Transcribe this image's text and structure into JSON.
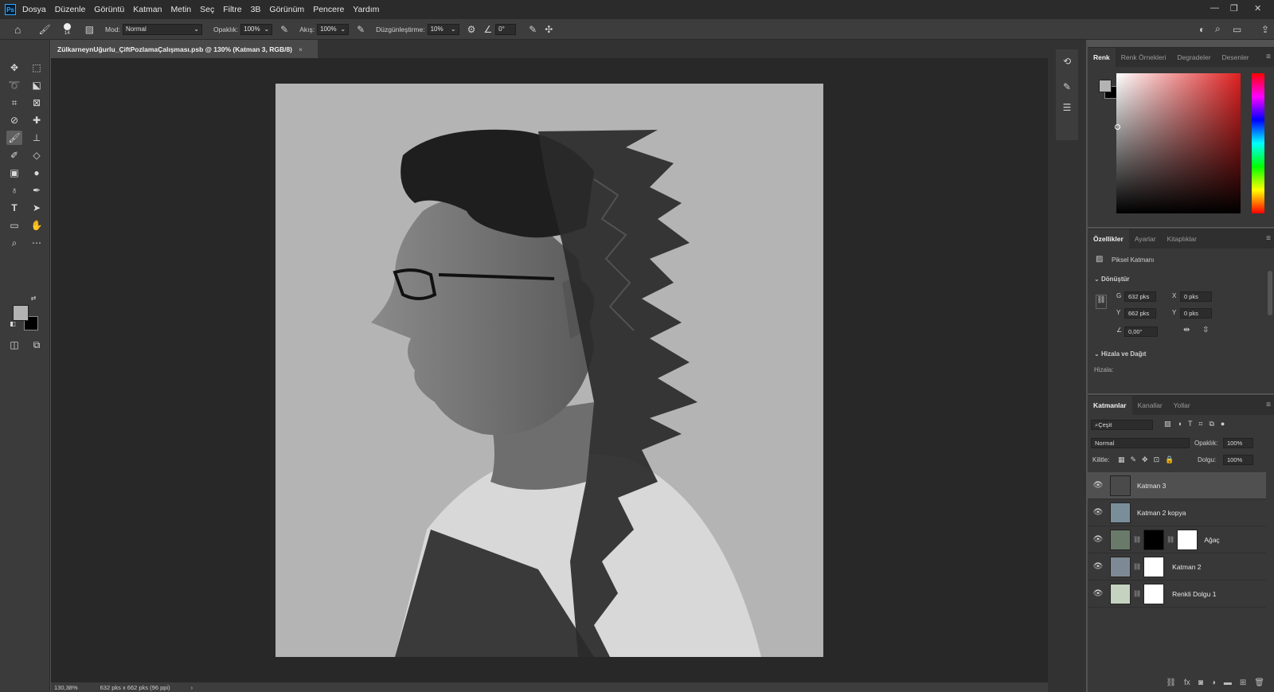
{
  "menubar": {
    "logo": "Ps",
    "items": [
      "Dosya",
      "Düzenle",
      "Görüntü",
      "Katman",
      "Metin",
      "Seç",
      "Filtre",
      "3B",
      "Görünüm",
      "Pencere",
      "Yardım"
    ],
    "win_controls": [
      "—",
      "❐",
      "✕"
    ]
  },
  "options": {
    "brush_size": "14",
    "mode_label": "Mod:",
    "mode_value": "Normal",
    "opacity_label": "Opaklık:",
    "opacity_value": "100%",
    "flow_label": "Akış:",
    "flow_value": "100%",
    "smoothing_label": "Düzgünleştirme:",
    "smoothing_value": "10%",
    "angle_value": "0°"
  },
  "document": {
    "tab_title": "ZülkarneynUğurlu_ÇiftPozlamaÇalışması.psb @ 130% (Katman 3, RGB/8)",
    "tab_close": "×",
    "zoom": "130,38%",
    "size_info": "632 pks x 662 pks (96 ppi)",
    "status_arrow": "›"
  },
  "color_panel": {
    "tabs": [
      "Renk",
      "Renk Örnekleri",
      "Degradeler",
      "Desenler"
    ],
    "active_tab": 0,
    "foreground": "#b3b3b3",
    "background": "#000000",
    "hue_color": "#e02020"
  },
  "properties_panel": {
    "tabs": [
      "Özellikler",
      "Ayarlar",
      "Kitaplıklar"
    ],
    "active_tab": 0,
    "layer_type": "Piksel Katmanı",
    "transform_title": "Dönüştür",
    "w_label": "G",
    "w_value": "632 pks",
    "h_label": "Y",
    "h_value": "662 pks",
    "x_label": "X",
    "x_value": "0 pks",
    "y_label": "Y",
    "y_value": "0 pks",
    "angle_value": "0,00°",
    "align_title": "Hizala ve Dağıt",
    "align_label": "Hizala:"
  },
  "layers_panel": {
    "tabs": [
      "Katmanlar",
      "Kanallar",
      "Yollar"
    ],
    "active_tab": 0,
    "filter_value": "Çeşit",
    "blend_mode": "Normal",
    "opacity_label": "Opaklık:",
    "opacity_value": "100%",
    "lock_label": "Kilitle:",
    "fill_label": "Dolgu:",
    "fill_value": "100%",
    "layers": [
      {
        "name": "Katman 3",
        "selected": true,
        "thumb": "#4a4a4a",
        "mask": false
      },
      {
        "name": "Katman 2 kopya",
        "selected": false,
        "thumb": "#7a8e9a",
        "mask": false
      },
      {
        "name": "Ağaç",
        "selected": false,
        "thumb": "#6a7a6a",
        "mask": true,
        "extra_mask": true
      },
      {
        "name": "Katman 2",
        "selected": false,
        "thumb": "#7d8a95",
        "mask": true
      },
      {
        "name": "Renkli Dolgu 1",
        "selected": false,
        "thumb": "#c6d2c0",
        "mask": true
      }
    ]
  }
}
